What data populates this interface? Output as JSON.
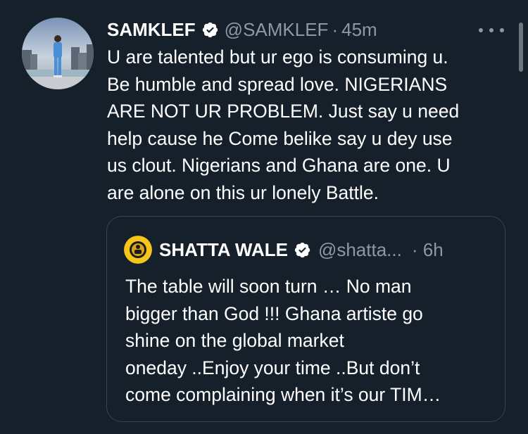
{
  "tweet": {
    "display_name": "SAMKLEF",
    "handle": "@SAMKLEF",
    "separator": "·",
    "time": "45m",
    "verified_icon": "verified-badge-icon",
    "more_icon": "more-options-icon",
    "body_lines": [
      "U are talented but ur ego is consuming u.",
      "Be humble and spread love. NIGERIANS",
      "ARE NOT UR PROBLEM.  Just say u need",
      "help cause he Come belike say u dey use",
      "us clout.  Nigerians and Ghana are one.  U",
      "are alone on this ur lonely Battle."
    ]
  },
  "quote": {
    "display_name": "SHATTA WALE",
    "handle": "@shatta...",
    "time": "· 6h",
    "verified_icon": "verified-badge-icon",
    "body_lines": [
      "The table will soon turn … No man",
      "bigger than God !!! Ghana artiste go",
      "shine on the global market",
      "oneday ..Enjoy your time ..But don’t",
      "come complaining when it’s our TIM…"
    ]
  },
  "colors": {
    "background": "#15202b",
    "text_primary": "#ffffff",
    "text_secondary": "#8b98a5",
    "border": "#38444d",
    "quote_avatar": "#f5c518"
  }
}
